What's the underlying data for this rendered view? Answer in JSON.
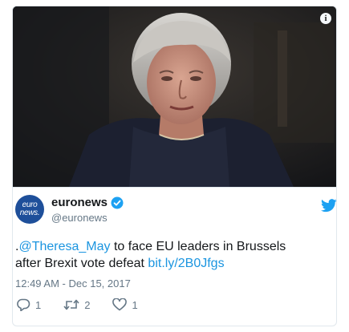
{
  "tweet": {
    "display_name": "euronews",
    "handle": "@euronews",
    "avatar_text_line1": "euro",
    "avatar_text_line2": "news.",
    "text_prefix": ".",
    "mention": "@Theresa_May",
    "text_body": " to face EU leaders in Brussels after Brexit vote defeat ",
    "link": "bit.ly/2B0Jfgs",
    "timestamp": "12:49 AM - Dec 15, 2017",
    "reply_count": "1",
    "retweet_count": "2",
    "like_count": "1"
  },
  "media": {
    "info_label": "i"
  },
  "colors": {
    "twitter_blue": "#1da1f2",
    "link_blue": "#1b95e0",
    "secondary_text": "#657786",
    "avatar_blue": "#1e4f9a"
  },
  "icons": {
    "verified": "verified-badge-icon",
    "brand": "twitter-bird-icon",
    "reply": "reply-icon",
    "retweet": "retweet-icon",
    "like": "heart-icon"
  }
}
